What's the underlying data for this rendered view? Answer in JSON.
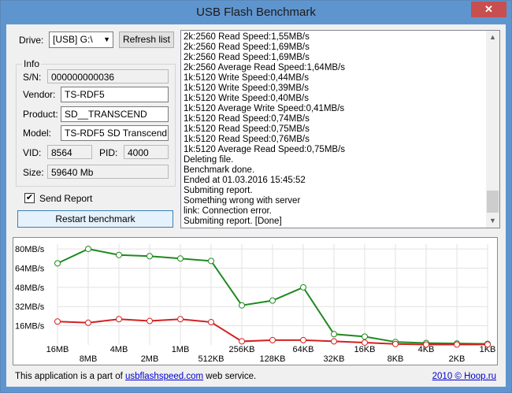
{
  "window": {
    "title": "USB Flash Benchmark",
    "close_glyph": "✕"
  },
  "drive": {
    "label": "Drive:",
    "value": "[USB] G:\\",
    "refresh_label": "Refresh list"
  },
  "info": {
    "group_label": "Info",
    "sn_label": "S/N:",
    "sn_value": "000000000036",
    "vendor_label": "Vendor:",
    "vendor_value": "TS-RDF5",
    "product_label": "Product:",
    "product_value": "SD__TRANSCEND",
    "model_label": "Model:",
    "model_value": "TS-RDF5 SD  Transcend",
    "vid_label": "VID:",
    "vid_value": "8564",
    "pid_label": "PID:",
    "pid_value": "4000",
    "size_label": "Size:",
    "size_value": "59640 Mb"
  },
  "send_report": {
    "label": "Send Report",
    "checked": true,
    "check_glyph": "✔"
  },
  "restart_label": "Restart benchmark",
  "log": [
    "2k:2560 Read Speed:1,55MB/s",
    "2k:2560 Read Speed:1,69MB/s",
    "2k:2560 Read Speed:1,69MB/s",
    "2k:2560 Average Read Speed:1,64MB/s",
    "1k:5120 Write Speed:0,44MB/s",
    "1k:5120 Write Speed:0,39MB/s",
    "1k:5120 Write Speed:0,40MB/s",
    "1k:5120 Average Write Speed:0,41MB/s",
    "1k:5120 Read Speed:0,74MB/s",
    "1k:5120 Read Speed:0,75MB/s",
    "1k:5120 Read Speed:0,76MB/s",
    "1k:5120 Average Read Speed:0,75MB/s",
    "Deleting file.",
    "Benchmark done.",
    "Ended at 01.03.2016 15:45:52",
    "Submiting report.",
    "Something wrong with server",
    "link: Connection error.",
    "Submiting report. [Done]"
  ],
  "chart_data": {
    "type": "line",
    "categories": [
      "16MB",
      "8MB",
      "4MB",
      "2MB",
      "1MB",
      "512KB",
      "256KB",
      "128KB",
      "64KB",
      "32KB",
      "16KB",
      "8KB",
      "4KB",
      "2KB",
      "1KB"
    ],
    "y_ticks": [
      "80MB/s",
      "64MB/s",
      "48MB/s",
      "32MB/s",
      "16MB/s"
    ],
    "y_tick_values": [
      80,
      64,
      48,
      32,
      16
    ],
    "ylim": [
      0,
      84
    ],
    "series": [
      {
        "color": "#1e8a1e",
        "values": [
          68,
          80,
          75,
          74,
          72,
          70,
          33,
          37,
          48,
          9,
          7,
          2.5,
          1.6,
          1.2,
          0.9
        ]
      },
      {
        "color": "#d42020",
        "values": [
          19.5,
          18.5,
          21.5,
          20,
          21.5,
          19,
          3,
          4,
          4,
          3,
          2,
          0.8,
          0.3,
          0.3,
          0.4
        ]
      }
    ],
    "grid": true
  },
  "footer": {
    "prefix": "This application is a part of ",
    "link": "usbflashspeed.com",
    "suffix": " web service.",
    "copyright": "2010 © Hoop.ru"
  }
}
